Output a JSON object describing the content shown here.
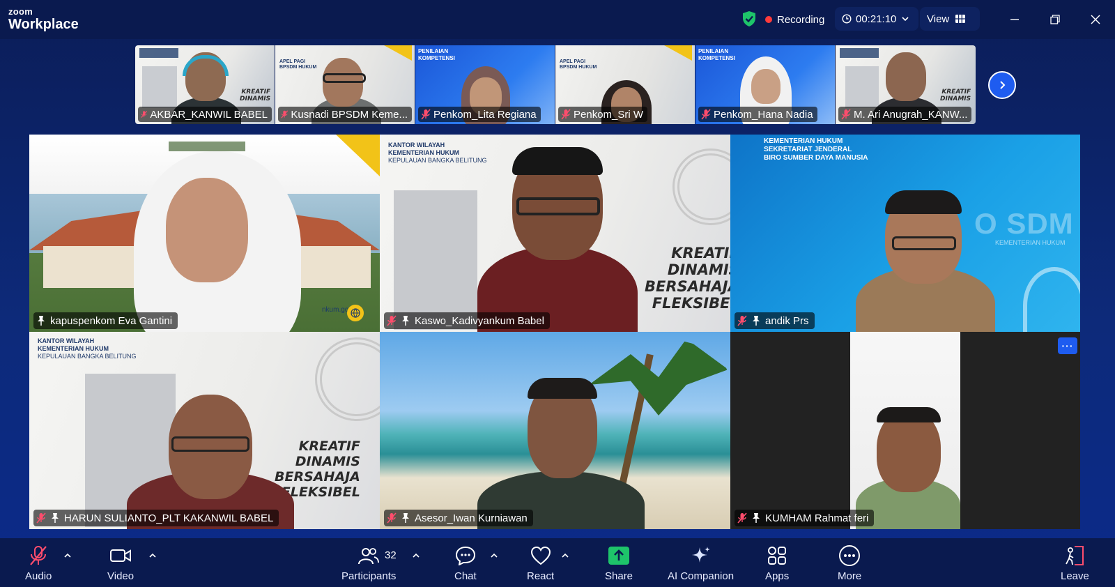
{
  "app": {
    "brand_line1": "zoom",
    "brand_line2": "Workplace"
  },
  "topbar": {
    "recording_label": "Recording",
    "timer": "00:21:10",
    "view_label": "View"
  },
  "strip": [
    {
      "name": "AKBAR_KANWIL BABEL"
    },
    {
      "name": "Kusnadi BPSDM Keme..."
    },
    {
      "name": "Penkom_Lita Regiana"
    },
    {
      "name": "Penkom_Sri W"
    },
    {
      "name": "Penkom_Hana Nadia"
    },
    {
      "name": "M. Ari Anugrah_KANW..."
    }
  ],
  "tiles": [
    {
      "name": "kapuspenkom Eva Gantini"
    },
    {
      "name": "Kaswo_Kadivyankum Babel"
    },
    {
      "name": "andik Prs"
    },
    {
      "name": "HARUN SULIANTO_PLT KAKANWIL BABEL"
    },
    {
      "name": "Asesor_Iwan Kurniawan"
    },
    {
      "name": "KUMHAM Rahmat feri"
    }
  ],
  "backgrounds": {
    "kreatif_1": "KREATIF",
    "kreatif_2": "DINAMIS",
    "kreatif_3": "BERSAHAJA",
    "kreatif_4": "FLEKSIBEL",
    "kanwil_l1": "KANTOR WILAYAH",
    "kanwil_l2": "KEMENTERIAN HUKUM",
    "kanwil_l3": "KEPULAUAN BANGKA BELITUNG",
    "biro_l1": "KEMENTERIAN HUKUM",
    "biro_l2": "SEKRETARIAT JENDERAL",
    "biro_l3": "BIRO SUMBER DAYA MANUSIA",
    "sdm_text": "O SDM",
    "sdm_sub": "KEMENTERIAN HUKUM",
    "url_fragment": "nkum.go.id",
    "apel_l1": "APEL PAGI",
    "apel_l2": "BPSDM HUKUM",
    "penilaian_l1": "PENILAIAN",
    "penilaian_l2": "KOMPETENSI"
  },
  "toolbar": {
    "audio": "Audio",
    "video": "Video",
    "participants": "Participants",
    "participants_count": "32",
    "chat": "Chat",
    "react": "React",
    "share": "Share",
    "ai_companion": "AI Companion",
    "apps": "Apps",
    "more": "More",
    "leave": "Leave"
  },
  "colors": {
    "accent": "#1e5cf0",
    "active_speaker": "#35d16a",
    "share": "#1ec46a",
    "leave": "#ff4d6d",
    "muted": "#ff4d6d"
  }
}
